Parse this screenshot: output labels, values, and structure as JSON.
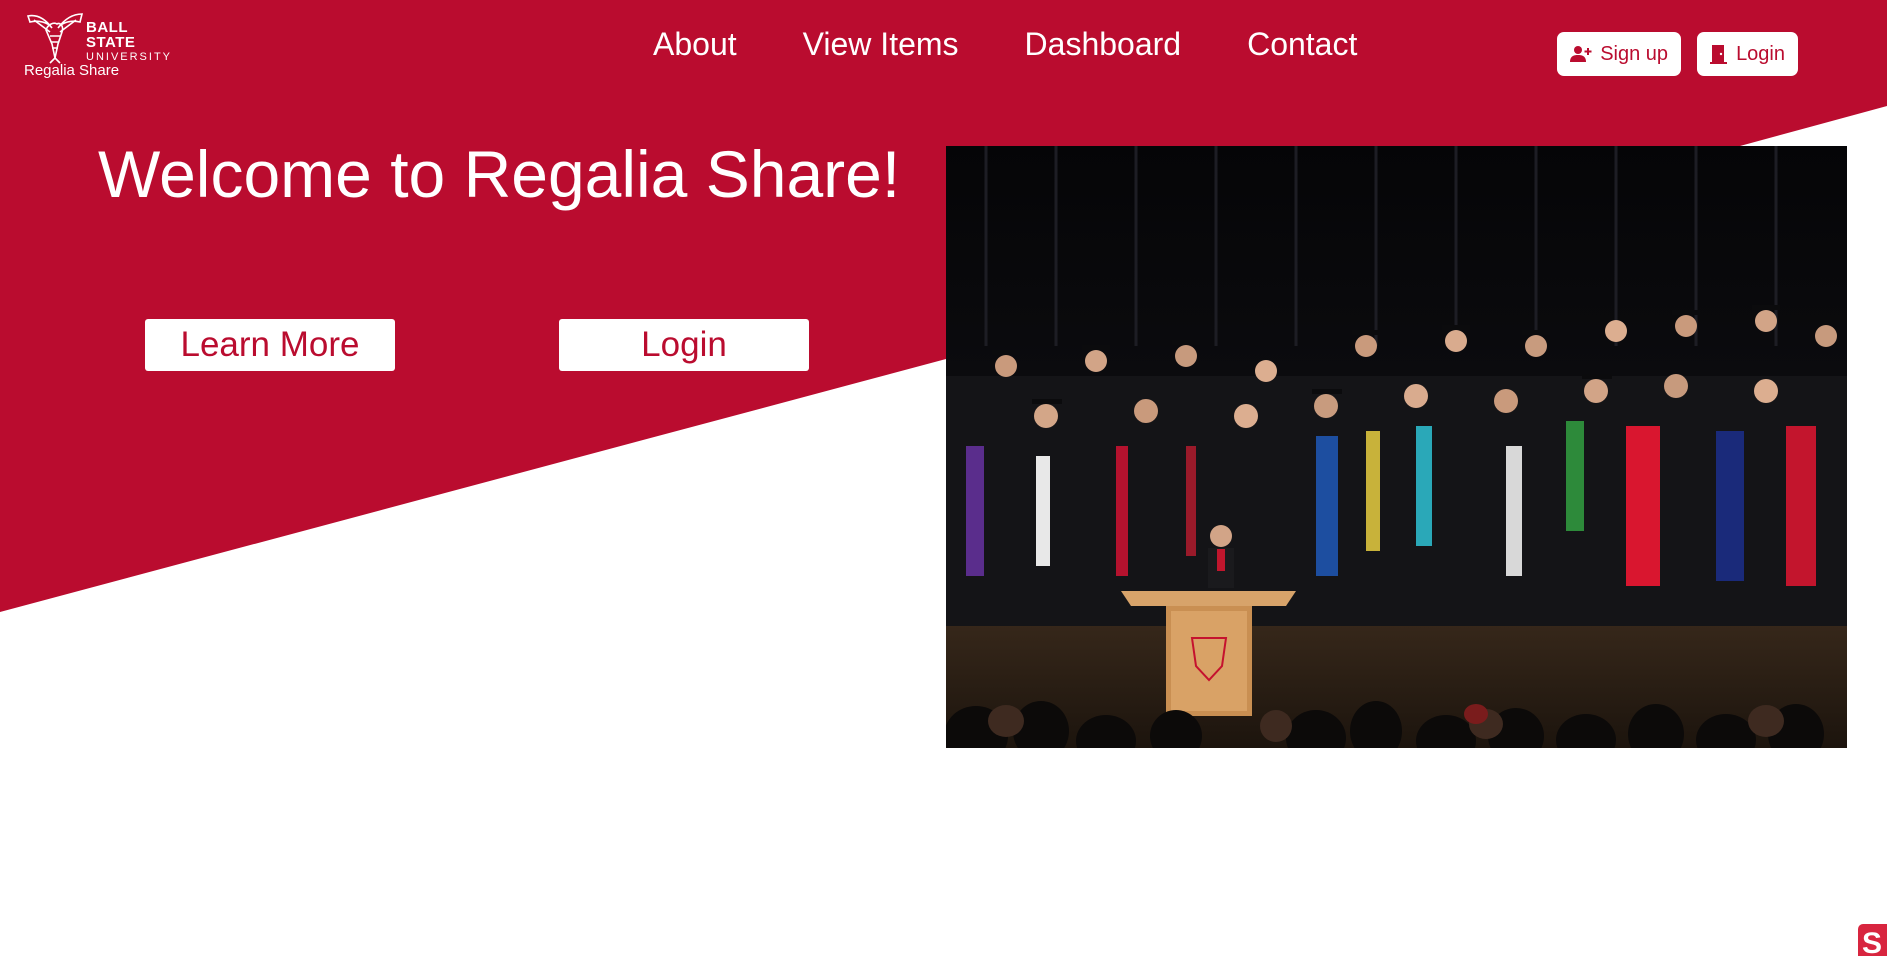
{
  "brand": {
    "university_line1": "BALL STATE",
    "university_line2": "UNIVERSITY",
    "app_name": "Regalia Share",
    "primary_color": "#ba0c2f",
    "accent_color": "#ffffff"
  },
  "nav": {
    "items": [
      {
        "label": "About"
      },
      {
        "label": "View Items"
      },
      {
        "label": "Dashboard"
      },
      {
        "label": "Contact"
      }
    ]
  },
  "auth": {
    "signup_label": "Sign up",
    "signup_icon": "user-plus-icon",
    "login_label": "Login",
    "login_icon": "door-icon"
  },
  "hero": {
    "headline": "Welcome to Regalia Share!",
    "learn_more_label": "Learn More",
    "login_label": "Login",
    "image_alt": "Graduation ceremony with faculty in academic regalia on stage"
  },
  "corner_badge": {
    "label": "S"
  }
}
